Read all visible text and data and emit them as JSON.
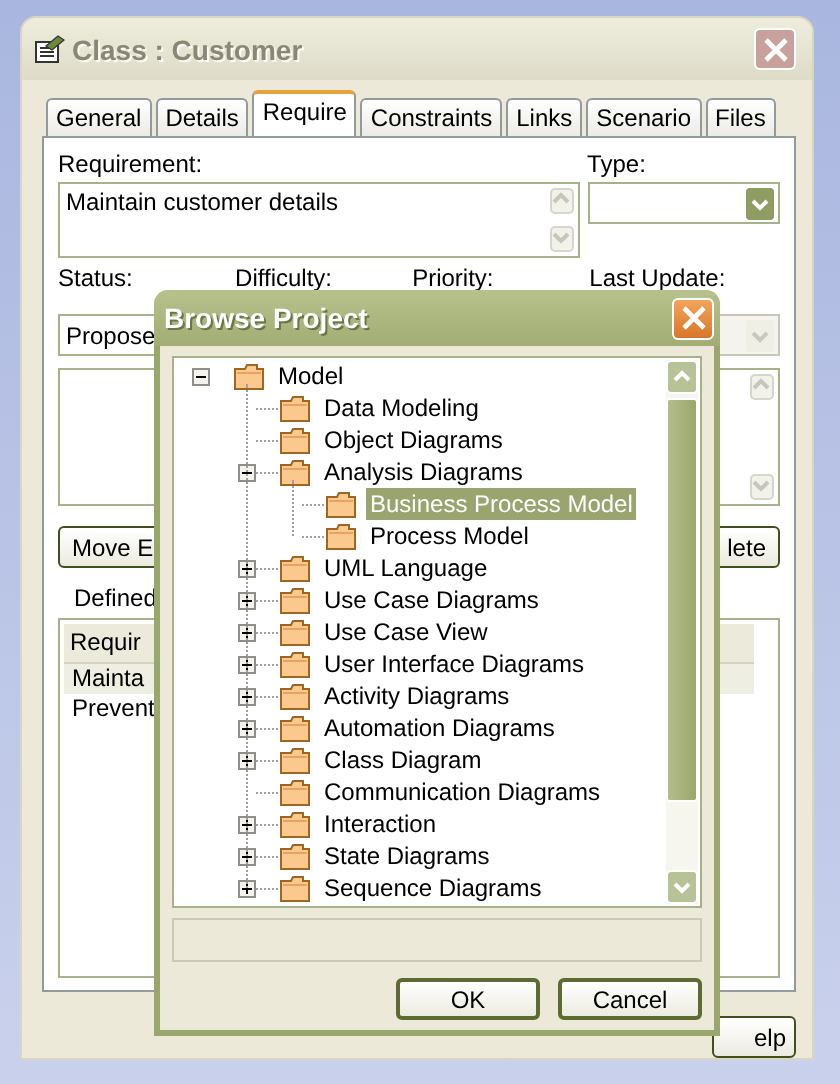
{
  "window": {
    "title": "Class : Customer"
  },
  "tabs": [
    {
      "label": "General",
      "selected": false
    },
    {
      "label": "Details",
      "selected": false
    },
    {
      "label": "Require",
      "selected": true
    },
    {
      "label": "Constraints",
      "selected": false
    },
    {
      "label": "Links",
      "selected": false
    },
    {
      "label": "Scenario",
      "selected": false
    },
    {
      "label": "Files",
      "selected": false
    }
  ],
  "requirement": {
    "label": "Requirement:",
    "value": "Maintain customer details"
  },
  "type": {
    "label": "Type:"
  },
  "fields": [
    {
      "label": "Status:",
      "value": "Propose",
      "disabled": false
    },
    {
      "label": "Difficulty:"
    },
    {
      "label": "Priority:"
    },
    {
      "label": "Last Update:",
      "disabled": true
    }
  ],
  "buttons": [
    "Move E",
    "lete"
  ],
  "defined_label": "Defined",
  "requirements_list": {
    "columns": [
      "Requir"
    ],
    "rows": [
      {
        "cells": [
          "Mainta"
        ],
        "selected": true
      },
      {
        "cells": [
          "Prevent"
        ],
        "selected": false
      }
    ]
  },
  "help_button": "elp",
  "browse_dialog": {
    "title": "Browse Project",
    "tree": [
      {
        "label": "Model",
        "expanded": true,
        "selected": false,
        "children": [
          {
            "label": "Data Modeling",
            "selected": false
          },
          {
            "label": "Object Diagrams",
            "selected": false
          },
          {
            "label": "Analysis Diagrams",
            "expanded": true,
            "selected": false,
            "children": [
              {
                "label": "Business Process Model",
                "selected": true
              },
              {
                "label": "Process Model",
                "selected": false
              }
            ]
          },
          {
            "label": "UML Language",
            "expanded": false,
            "selected": false
          },
          {
            "label": "Use Case Diagrams",
            "expanded": false,
            "selected": false
          },
          {
            "label": "Use Case View",
            "expanded": false,
            "selected": false
          },
          {
            "label": "User Interface Diagrams",
            "expanded": false,
            "selected": false
          },
          {
            "label": "Activity Diagrams",
            "expanded": false,
            "selected": false
          },
          {
            "label": "Automation Diagrams",
            "expanded": false,
            "selected": false
          },
          {
            "label": "Class Diagram",
            "expanded": false,
            "selected": false
          },
          {
            "label": "Communication Diagrams",
            "selected": false
          },
          {
            "label": "Interaction",
            "expanded": false,
            "selected": false
          },
          {
            "label": "State Diagrams",
            "expanded": false,
            "selected": false
          },
          {
            "label": "Sequence Diagrams",
            "expanded": false,
            "selected": false
          }
        ]
      }
    ],
    "buttons": [
      "OK",
      "Cancel"
    ]
  }
}
